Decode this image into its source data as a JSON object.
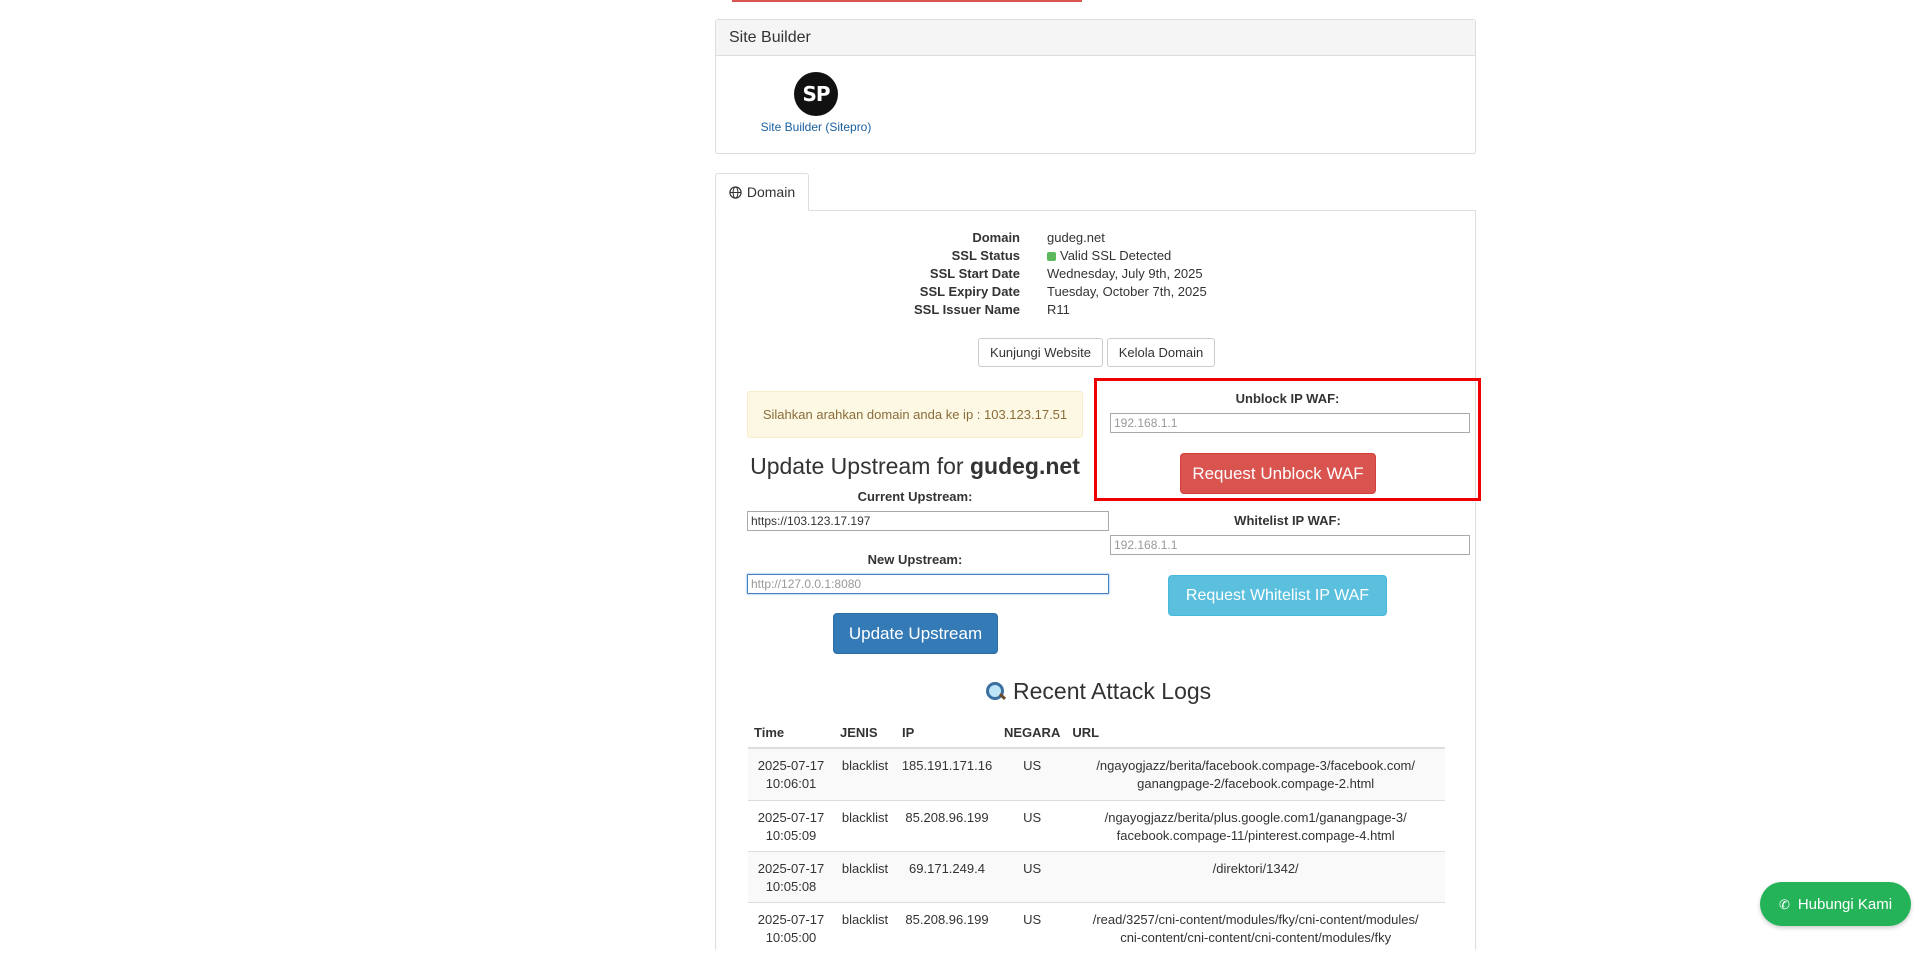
{
  "site_builder": {
    "heading": "Site Builder",
    "logo_text": "SP",
    "link_label": "Site Builder (Sitepro)"
  },
  "domain_tab": {
    "label": "Domain",
    "icon": "globe-icon"
  },
  "domain_info": {
    "rows": [
      {
        "label": "Domain",
        "value": "gudeg.net"
      },
      {
        "label": "SSL Status",
        "value": "Valid SSL Detected"
      },
      {
        "label": "SSL Start Date",
        "value": "Wednesday, July 9th, 2025"
      },
      {
        "label": "SSL Expiry Date",
        "value": "Tuesday, October 7th, 2025"
      },
      {
        "label": "SSL Issuer Name",
        "value": "R11"
      }
    ]
  },
  "actions": {
    "visit_website": "Kunjungi Website",
    "manage_domain": "Kelola Domain"
  },
  "alert": {
    "text": "Silahkan arahkan domain anda ke ip : 103.123.17.51"
  },
  "upstream": {
    "title_prefix": "Update Upstream for",
    "title_domain": "gudeg.net",
    "current_label": "Current Upstream:",
    "current_value": "https://103.123.17.197",
    "new_label": "New Upstream:",
    "new_placeholder": "http://127.0.0.1:8080",
    "update_button": "Update Upstream"
  },
  "waf": {
    "unblock_label": "Unblock IP WAF:",
    "unblock_placeholder": "192.168.1.1",
    "unblock_button": "Request Unblock WAF",
    "whitelist_label": "Whitelist IP WAF:",
    "whitelist_placeholder": "192.168.1.1",
    "whitelist_button": "Request Whitelist IP WAF"
  },
  "logs": {
    "title": "Recent Attack Logs",
    "columns": [
      "Time",
      "JENIS",
      "IP",
      "NEGARA",
      "URL"
    ],
    "rows": [
      {
        "date": "2025-07-17",
        "time": "10:06:01",
        "jenis": "blacklist",
        "ip": "185.191.171.16",
        "negara": "US",
        "url1": "/ngayogjazz/berita/facebook.compage-3/facebook.com/",
        "url2": "ganangpage-2/facebook.compage-2.html"
      },
      {
        "date": "2025-07-17",
        "time": "10:05:09",
        "jenis": "blacklist",
        "ip": "85.208.96.199",
        "negara": "US",
        "url1": "/ngayogjazz/berita/plus.google.com1/ganangpage-3/",
        "url2": "facebook.compage-11/pinterest.compage-4.html"
      },
      {
        "date": "2025-07-17",
        "time": "10:05:08",
        "jenis": "blacklist",
        "ip": "69.171.249.4",
        "negara": "US",
        "url1": "/direktori/1342/",
        "url2": ""
      },
      {
        "date": "2025-07-17",
        "time": "10:05:00",
        "jenis": "blacklist",
        "ip": "85.208.96.199",
        "negara": "US",
        "url1": "/read/3257/cni-content/modules/fky/cni-content/modules/",
        "url2": "cni-content/cni-content/cni-content/modules/fky"
      }
    ]
  },
  "contact": {
    "label": "Hubungi Kami",
    "icon": "phone-icon"
  }
}
